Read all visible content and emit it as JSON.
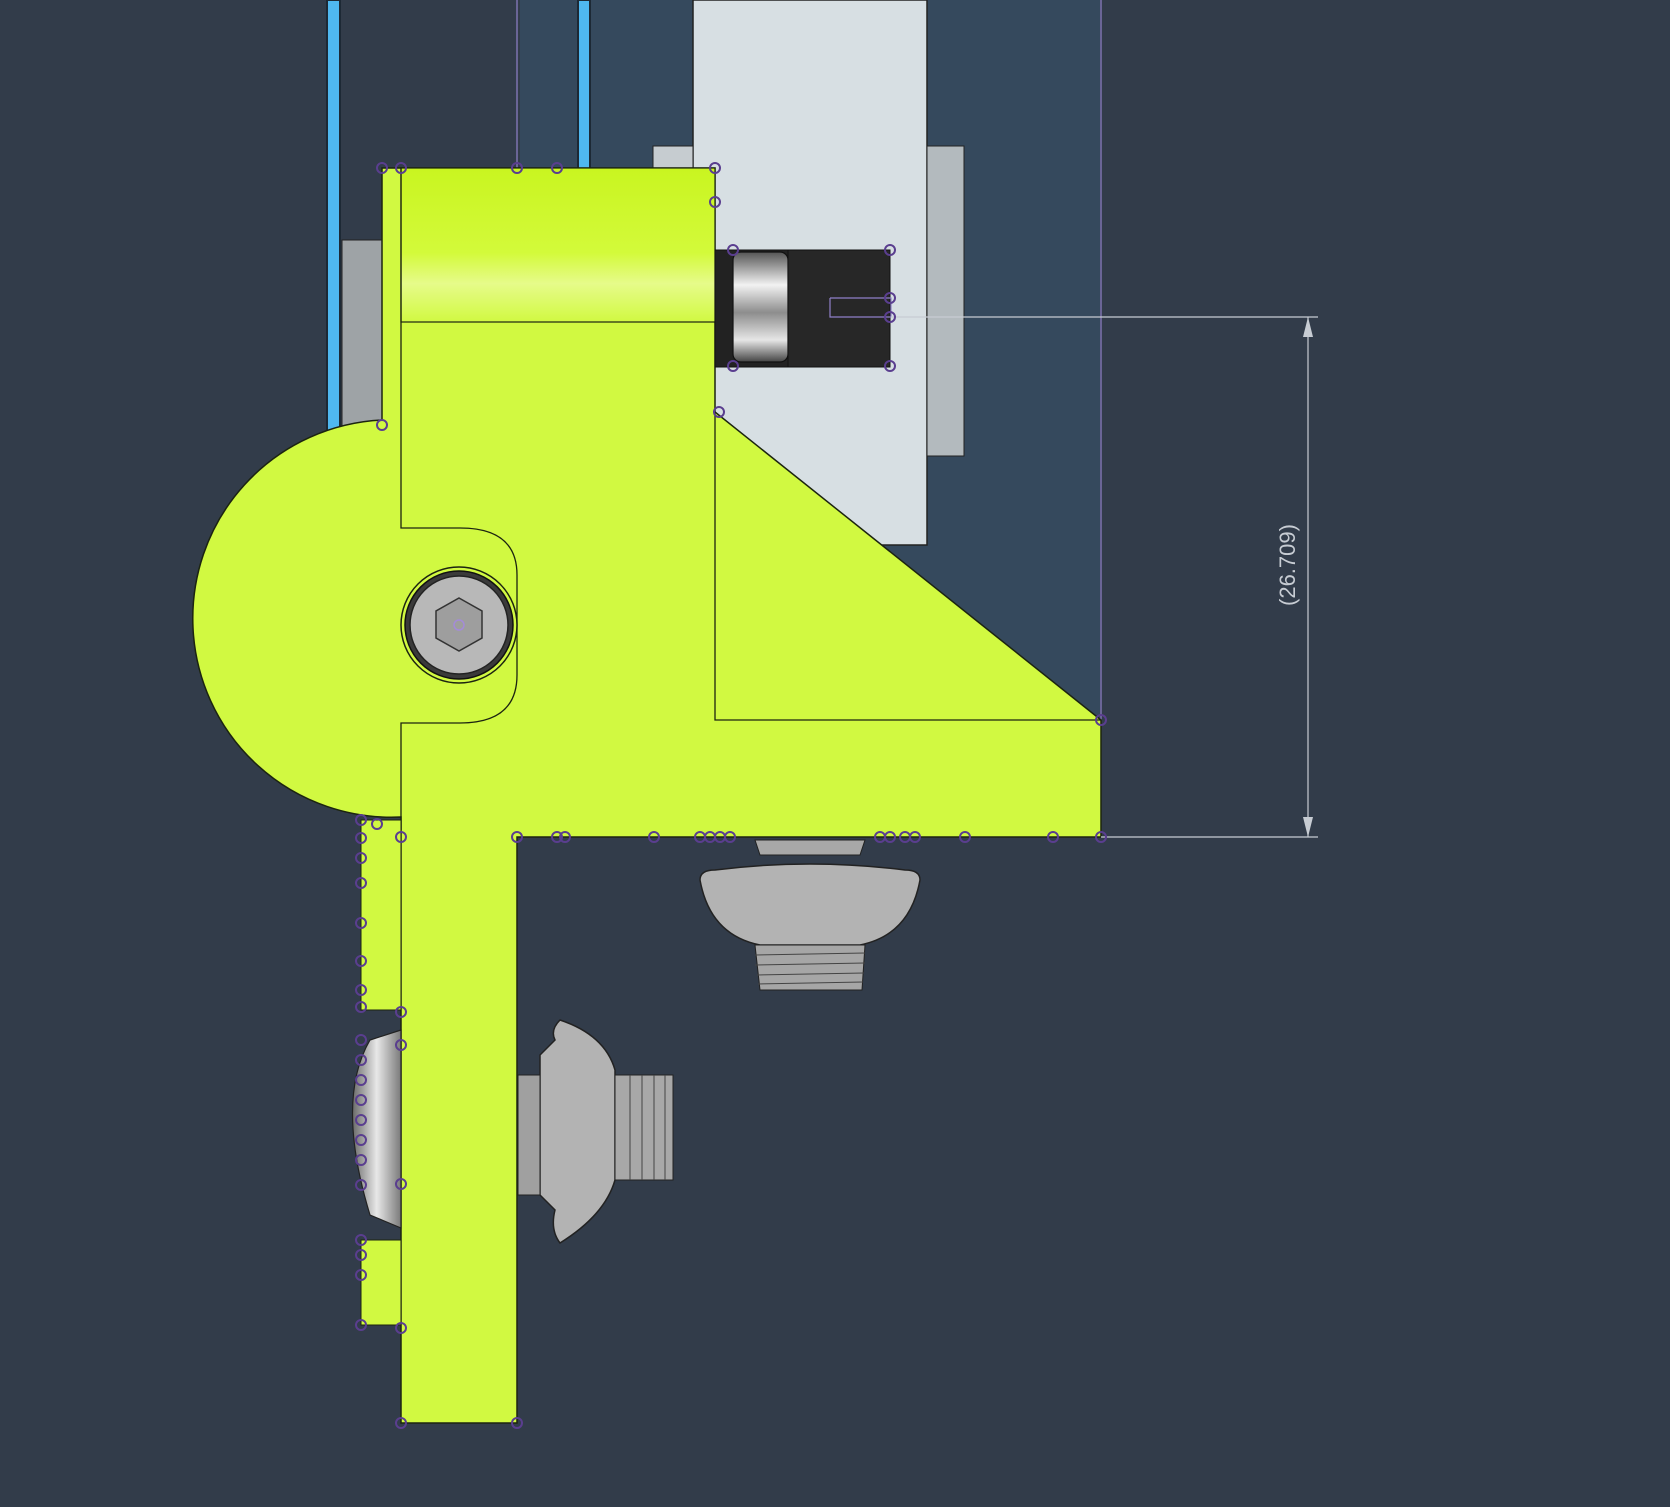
{
  "viewport": {
    "background": "#323c4a",
    "part_color": "#d1f941",
    "part_highlight": "#c8f51c",
    "sketch_point_color": "#5a3e8f",
    "sketch_line_color": "#8f80c8",
    "frame_color": "#d7dfe3",
    "rail_color": "#4fb8f0",
    "hardware_color": "#b3b3b3"
  },
  "dimension": {
    "label": "(26.709)",
    "color": "#c7ccd3"
  },
  "icons": {
    "hex_socket_bolt": "hex-socket-bolt-icon",
    "bearing": "bearing-icon",
    "button_head_screw": "button-head-screw-icon"
  }
}
